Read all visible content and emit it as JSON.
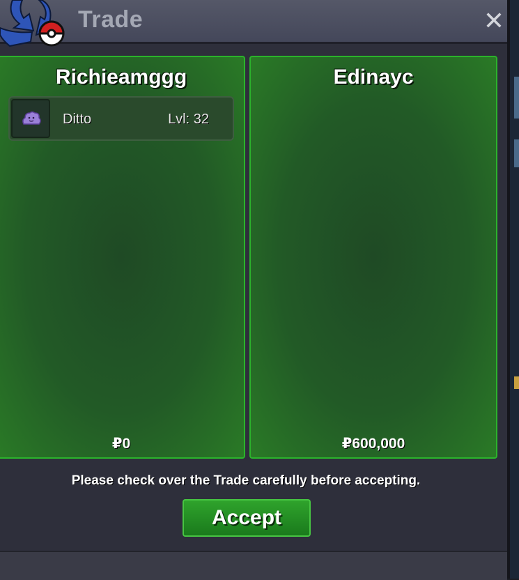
{
  "window": {
    "title": "Trade",
    "close_glyph": "✕"
  },
  "trade": {
    "left": {
      "player": "Richieamggg",
      "items": [
        {
          "name": "Ditto",
          "level": "Lvl: 32",
          "icon": "ditto-sprite-icon"
        }
      ],
      "money": "₽0"
    },
    "right": {
      "player": "Edinayc",
      "items": [],
      "money": "₽600,000"
    }
  },
  "footer": {
    "notice": "Please check over the Trade carefully before accepting.",
    "accept_label": "Accept"
  },
  "colors": {
    "panel_border": "#2bb32b",
    "accept_bg": "#2fa32c",
    "titlebar": "#4a4d5e"
  }
}
